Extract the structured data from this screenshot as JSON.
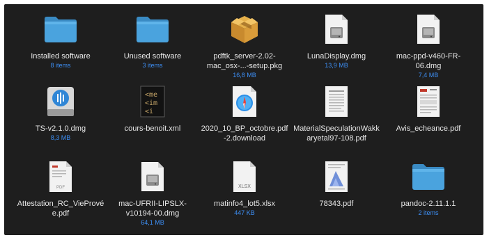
{
  "window": {
    "title": "Finder icon view"
  },
  "colors": {
    "background": "#1e1e1e",
    "folder": "#4aa3de",
    "folder_tab": "#3a8bc4",
    "filename": "#e8e8e8",
    "subtitle": "#3d8ff5",
    "document": "#f2f2f2"
  },
  "files": [
    {
      "name": "Installed software",
      "sub": "8 items",
      "icon": "folder-icon"
    },
    {
      "name": "Unused software",
      "sub": "3 items",
      "icon": "folder-icon"
    },
    {
      "name": "pdftk_server-2.02-mac_osx-...-setup.pkg",
      "sub": "16,8 MB",
      "icon": "package-icon"
    },
    {
      "name": "LunaDisplay.dmg",
      "sub": "13,9 MB",
      "icon": "disk-image-icon"
    },
    {
      "name": "mac-ppd-v460-FR-06.dmg",
      "sub": "7,4 MB",
      "icon": "disk-image-icon"
    },
    {
      "name": "TS-v2.1.0.dmg",
      "sub": "8,3 MB",
      "icon": "disk-app-icon"
    },
    {
      "name": "cours-benoit.xml",
      "sub": "",
      "icon": "xml-file-icon"
    },
    {
      "name": "2020_10_BP_octobre.pdf-2.download",
      "sub": "",
      "icon": "safari-download-icon"
    },
    {
      "name": "MaterialSpeculationWakkaryetal97-108.pdf",
      "sub": "",
      "icon": "pdf-document-icon"
    },
    {
      "name": "Avis_echeance.pdf",
      "sub": "",
      "icon": "pdf-document-icon"
    },
    {
      "name": "Attestation_RC_VieProvée.pdf",
      "sub": "",
      "icon": "pdf-document-icon"
    },
    {
      "name": "mac-UFRII-LIPSLX-v10194-00.dmg",
      "sub": "64,1 MB",
      "icon": "disk-image-icon"
    },
    {
      "name": "matinfo4_lot5.xlsx",
      "sub": "447 KB",
      "icon": "xlsx-file-icon"
    },
    {
      "name": "78343.pdf",
      "sub": "",
      "icon": "pdf-chart-icon"
    },
    {
      "name": "pandoc-2.11.1.1",
      "sub": "2 items",
      "icon": "folder-icon"
    }
  ],
  "icon_text": {
    "xml_lines": [
      "<me",
      "<im",
      "<i"
    ],
    "xlsx_label": "XLSX",
    "pdf_label": "PDF"
  }
}
